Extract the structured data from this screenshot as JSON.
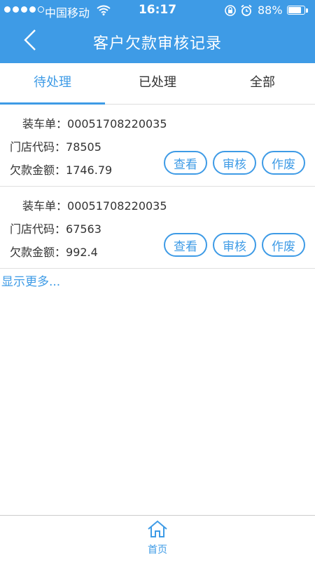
{
  "status_bar": {
    "carrier": "中国移动",
    "time": "16:17",
    "battery_percent": "88%",
    "battery_level": 0.88
  },
  "header": {
    "title": "客户欠款审核记录",
    "back_icon": "chevron-left-icon"
  },
  "tabs": [
    {
      "label": "待处理",
      "active": true
    },
    {
      "label": "已处理",
      "active": false
    },
    {
      "label": "全部",
      "active": false
    }
  ],
  "records": [
    {
      "order_label": "装车单：",
      "order_no": "00051708220035",
      "store_label": "门店代码：",
      "store_code": "78505",
      "amount_label": "欠款金额：",
      "amount": "1746.79"
    },
    {
      "order_label": "装车单：",
      "order_no": "00051708220035",
      "store_label": "门店代码：",
      "store_code": "67563",
      "amount_label": "欠款金额：",
      "amount": "992.4"
    }
  ],
  "actions": {
    "view": "查看",
    "audit": "审核",
    "void": "作废"
  },
  "show_more": "显示更多...",
  "bottom_nav": {
    "home_label": "首页",
    "home_icon": "home-icon"
  },
  "colors": {
    "primary": "#3e9be6"
  }
}
